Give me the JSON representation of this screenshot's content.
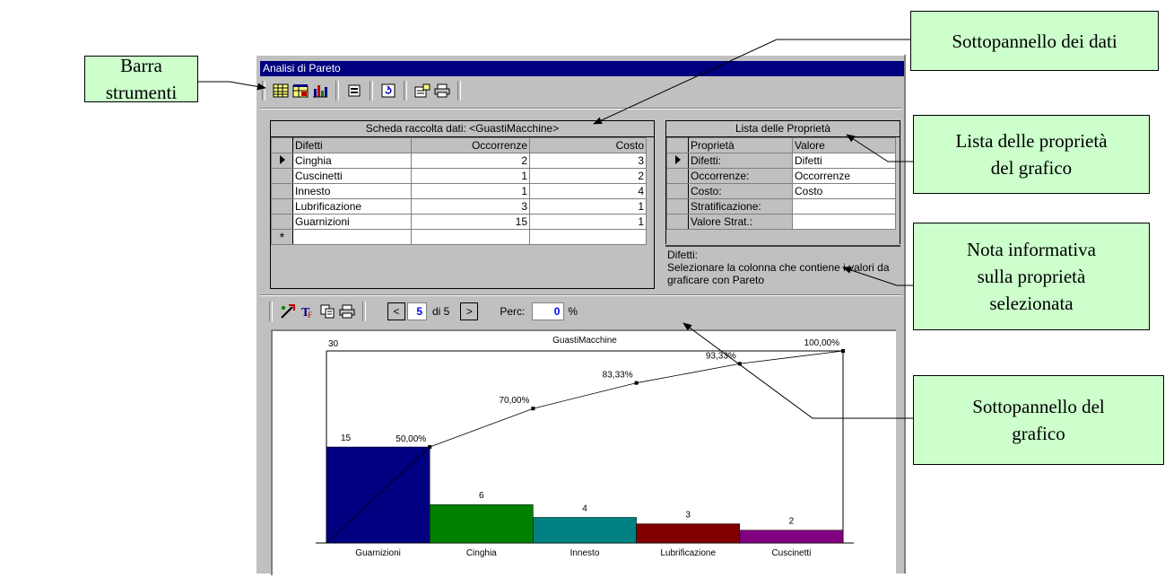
{
  "callouts": {
    "toolbar": "Barra strumenti",
    "data_panel": "Sottopannello dei dati",
    "properties": "Lista delle proprietà\ndel grafico",
    "note": "Nota informativa\nsulla proprietà\nselezionata",
    "chart_panel": "Sottopannello del\ngrafico"
  },
  "window": {
    "title": "Analisi di Pareto"
  },
  "toolbar": {
    "icons": [
      "table-icon",
      "table-properties-icon",
      "bar-chart-icon",
      "form-icon",
      "refresh-icon",
      "properties-icon",
      "print-icon"
    ]
  },
  "data_sheet": {
    "caption": "Scheda raccolta dati: <GuastiMacchine>",
    "columns": [
      "Difetti",
      "Occorrenze",
      "Costo"
    ],
    "rows": [
      [
        "Cinghia",
        "2",
        "3"
      ],
      [
        "Cuscinetti",
        "1",
        "2"
      ],
      [
        "Innesto",
        "1",
        "4"
      ],
      [
        "Lubrificazione",
        "3",
        "1"
      ],
      [
        "Guarnizioni",
        "15",
        "1"
      ]
    ],
    "new_row_marker": "*"
  },
  "properties": {
    "caption": "Lista delle Proprietà",
    "columns": [
      "Proprietà",
      "Valore"
    ],
    "rows": [
      [
        "Difetti:",
        "Difetti"
      ],
      [
        "Occorrenze:",
        "Occorrenze"
      ],
      [
        "Costo:",
        "Costo"
      ],
      [
        "Stratificazione:",
        ""
      ],
      [
        "Valore Strat.:",
        ""
      ]
    ]
  },
  "note": {
    "title": "Difetti:",
    "text": "Selezionare la colonna che contiene i valori da graficare con Pareto"
  },
  "chart_toolbar": {
    "icons": [
      "chart-wizard-icon",
      "font-icon",
      "copy-icon",
      "print-icon"
    ],
    "prev": "<",
    "page": "5",
    "of": "di 5",
    "next": ">",
    "perc_label": "Perc:",
    "perc_value": "0",
    "perc_unit": "%"
  },
  "chart_data": {
    "type": "bar",
    "title": "GuastiMacchine",
    "categories": [
      "Guarnizioni",
      "Cinghia",
      "Innesto",
      "Lubrificazione",
      "Cuscinetti"
    ],
    "values": [
      15,
      6,
      4,
      3,
      2
    ],
    "colors": [
      "#000080",
      "#008000",
      "#008080",
      "#800000",
      "#800080"
    ],
    "cumulative_percent": [
      50.0,
      70.0,
      83.33,
      93.33,
      100.0
    ],
    "cumulative_labels": [
      "50,00%",
      "70,00%",
      "83,33%",
      "93,33%",
      "100,00%"
    ],
    "ylim": [
      0,
      30
    ],
    "ymax_label": "30",
    "xlabel": "",
    "ylabel": ""
  }
}
